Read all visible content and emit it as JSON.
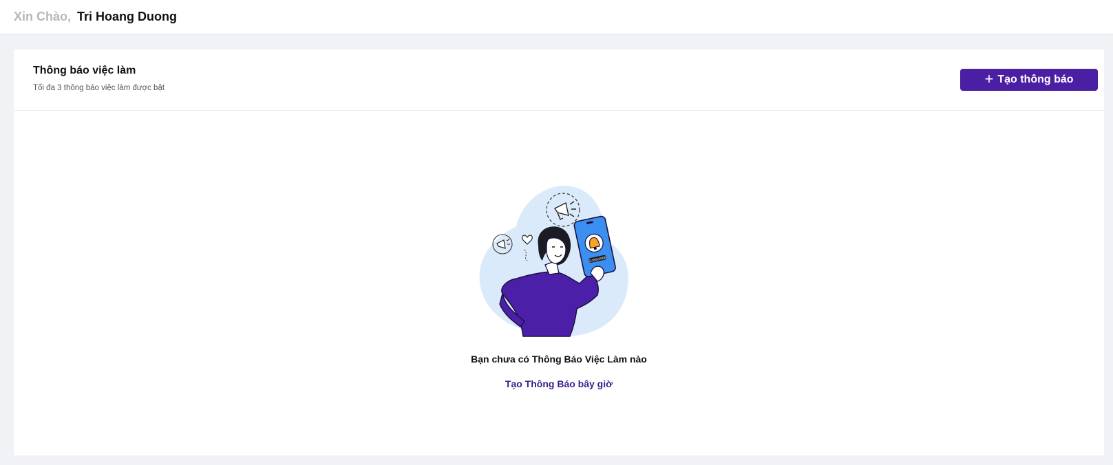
{
  "header": {
    "greeting": "Xin Chào,",
    "username": "Tri Hoang Duong"
  },
  "job_alerts": {
    "title": "Thông báo việc làm",
    "subtitle": "Tối đa 3 thông báo việc làm được bật",
    "create_button_label": "Tạo thông báo",
    "create_button_icon": "plus-icon",
    "empty_state": {
      "illustration": "woman-holding-phone-subscribe-illustration",
      "phone_label": "SUBSCRIBE",
      "message": "Bạn chưa có Thông Báo Việc Làm nào",
      "link_label": "Tạo Thông Báo bây giờ"
    }
  },
  "colors": {
    "accent": "#4a1fa3",
    "link": "#3a1d8c",
    "blob": "#dbeafb",
    "phone": "#3b8ff0",
    "sweater": "#4b1fa8"
  }
}
